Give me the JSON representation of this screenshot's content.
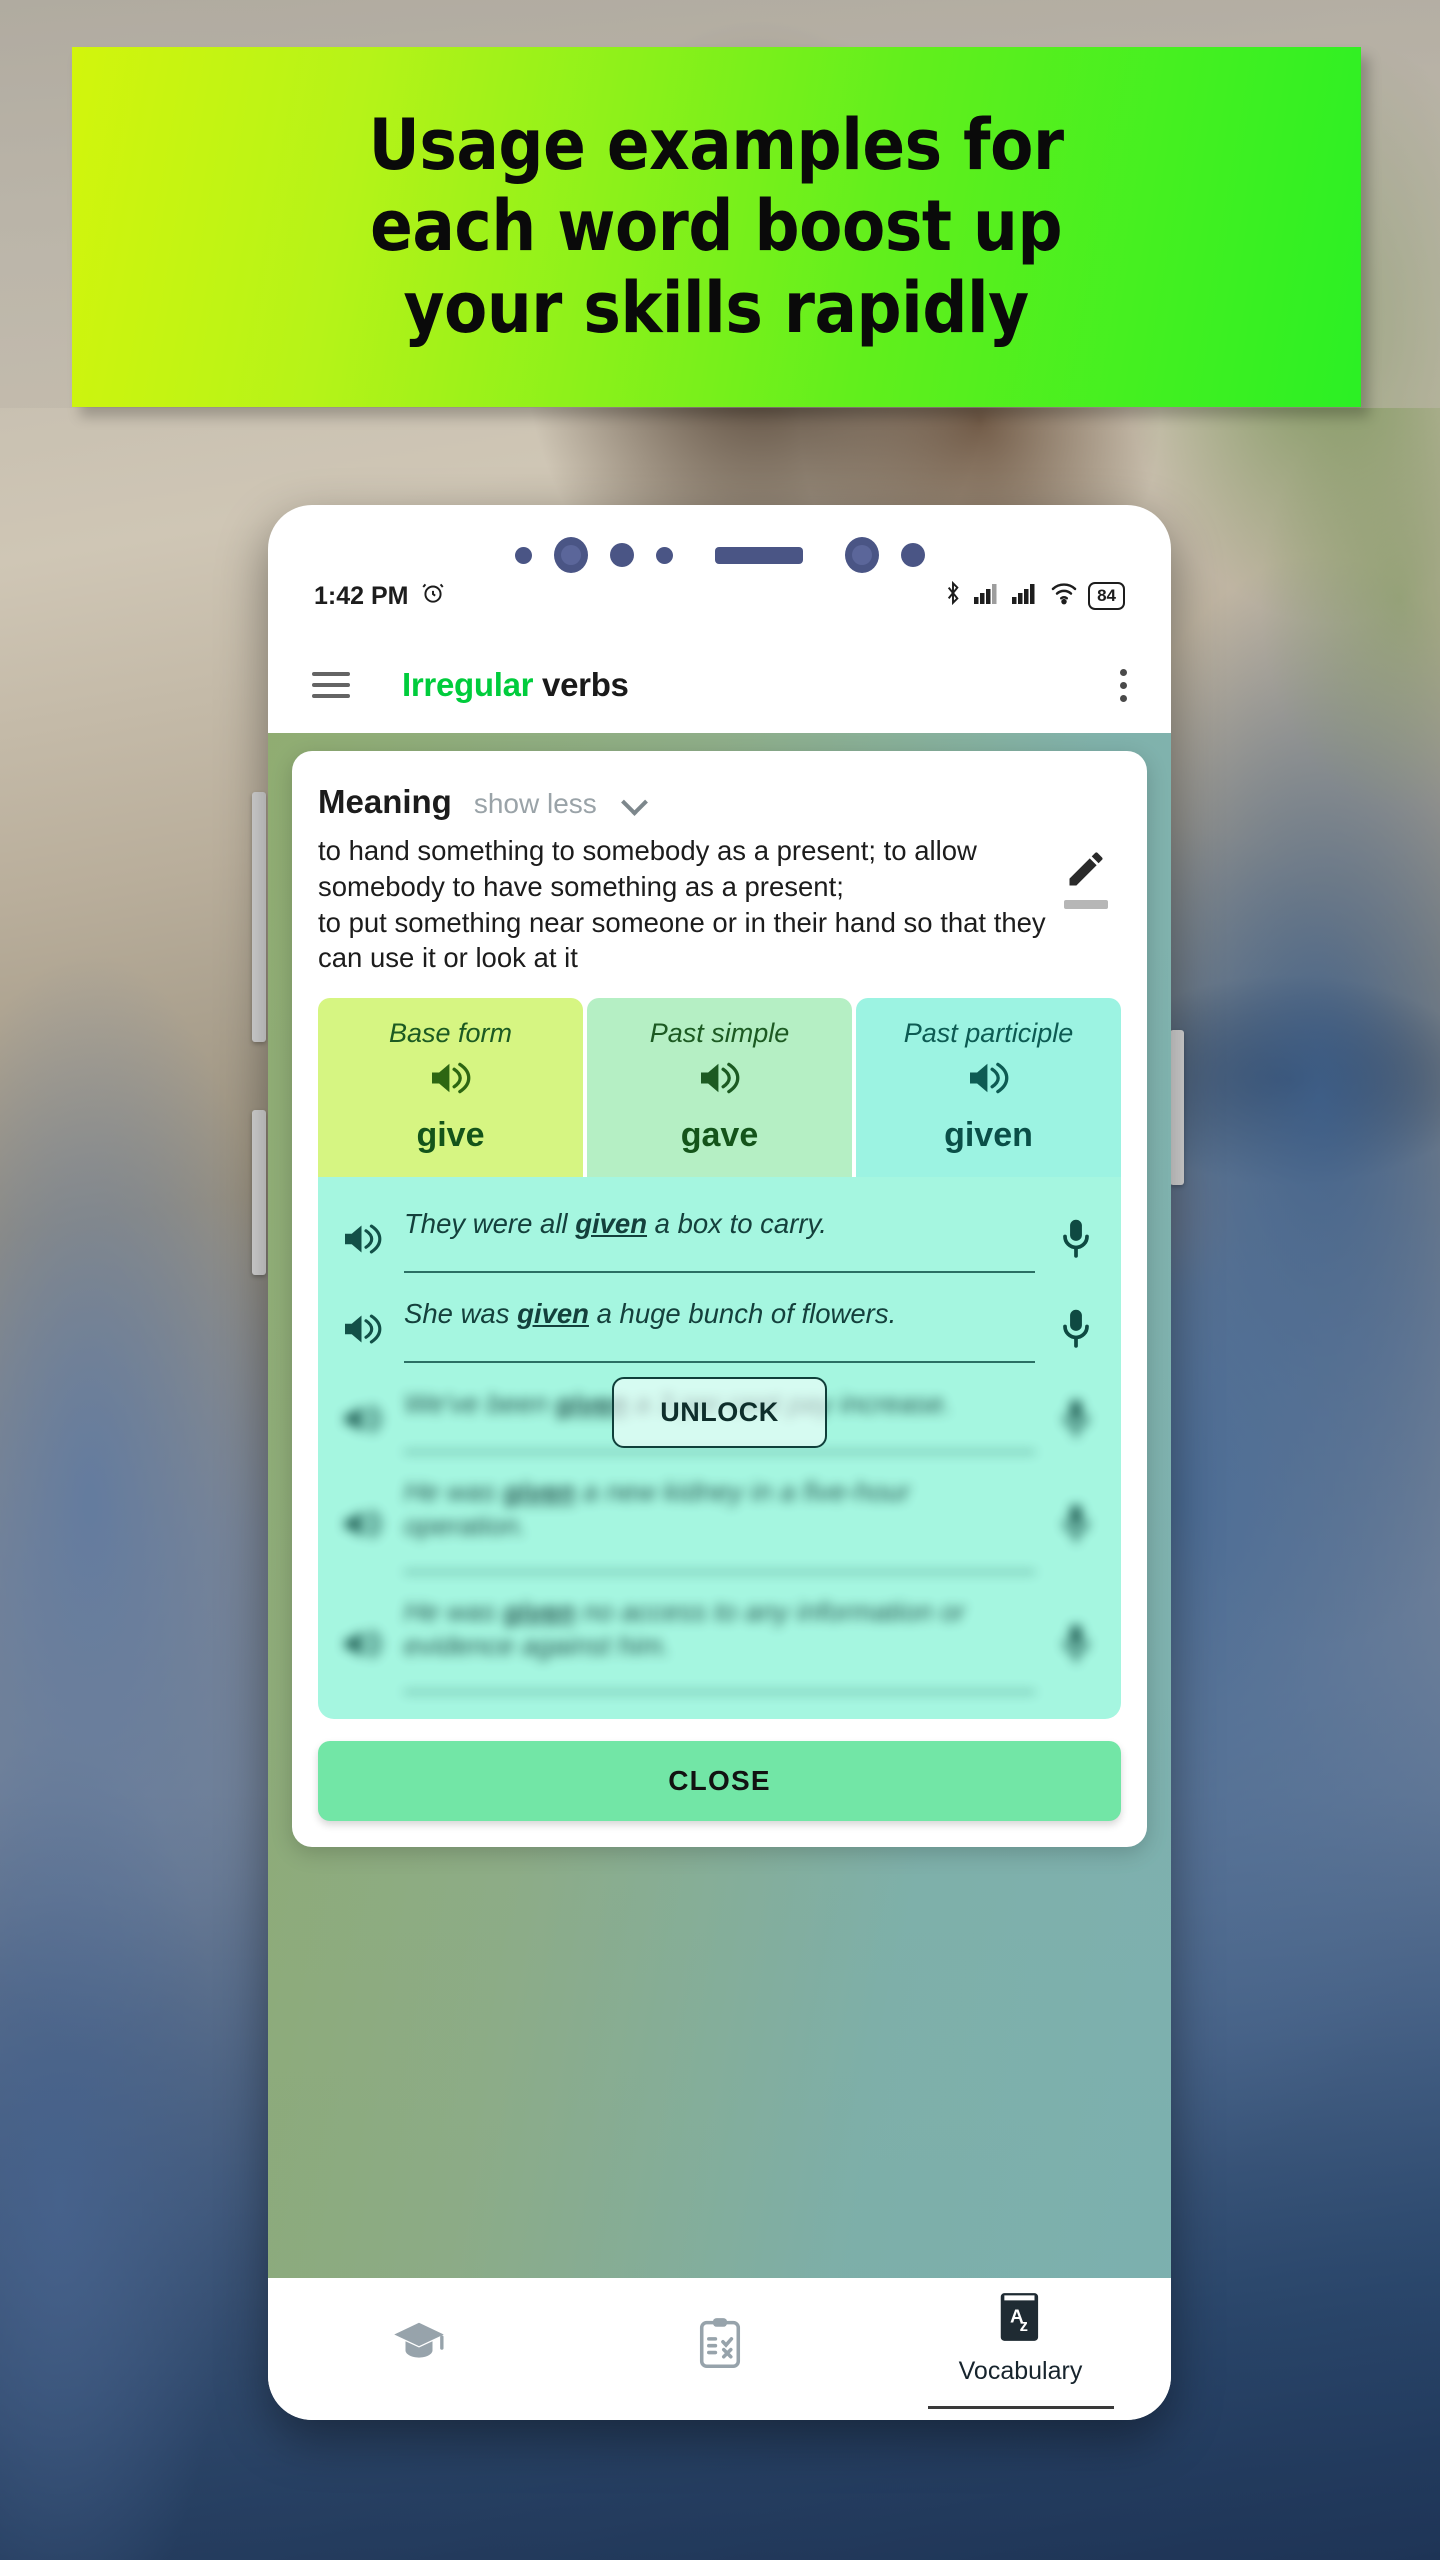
{
  "promo": {
    "headline": "Usage examples for\neach word boost up\nyour skills rapidly",
    "banner_gradient_from": "#d2f50c",
    "banner_gradient_to": "#2bf024"
  },
  "phone": {
    "statusbar": {
      "time": "1:42 PM",
      "alarm_icon": "alarm-icon",
      "bluetooth_icon": "bluetooth-icon",
      "signal_icon_1": "cellular-signal-icon",
      "signal_icon_2": "cellular-signal-icon",
      "wifi_icon": "wifi-icon",
      "battery_level": "84"
    },
    "appbar": {
      "menu_icon": "hamburger-menu-icon",
      "title_accent": "Irregular",
      "title_rest": " verbs",
      "accent_color": "#00cc3c",
      "overflow_icon": "kebab-menu-icon"
    }
  },
  "modal": {
    "meaning": {
      "title": "Meaning",
      "toggle_label": "show less",
      "toggle_icon": "chevron-down-icon",
      "text": "  to hand something to somebody as a present; to allow somebody to have something as a present;\n  to put something near someone or in their hand so that they can use it or look at it",
      "edit_icon": "pencil-edit-icon"
    },
    "forms": [
      {
        "label": "Base form",
        "word": "give",
        "speaker_icon": "speaker-icon",
        "bg": "#d6f582"
      },
      {
        "label": "Past simple",
        "word": "gave",
        "speaker_icon": "speaker-icon",
        "bg": "#b5efc4"
      },
      {
        "label": "Past participle",
        "word": "given",
        "speaker_icon": "speaker-icon",
        "bg": "#9cf3e2"
      }
    ],
    "examples": [
      {
        "before": "They were all ",
        "highlight": "given",
        "after": " a box to carry.",
        "locked": false,
        "speaker_icon": "speaker-icon",
        "mic_icon": "microphone-icon"
      },
      {
        "before": "She was ",
        "highlight": "given",
        "after": " a huge bunch of flowers.",
        "locked": false,
        "speaker_icon": "speaker-icon",
        "mic_icon": "microphone-icon"
      },
      {
        "before": "We've been ",
        "highlight": "given",
        "after": " a 3 per cent pay increase.",
        "locked": true,
        "speaker_icon": "speaker-icon",
        "mic_icon": "microphone-icon"
      },
      {
        "before": "He was ",
        "highlight": "given",
        "after": " a new kidney in a five-hour operation.",
        "locked": true,
        "speaker_icon": "speaker-icon",
        "mic_icon": "microphone-icon"
      },
      {
        "before": "He was ",
        "highlight": "given",
        "after": " no access to any information or evidence against him.",
        "locked": true,
        "speaker_icon": "speaker-icon",
        "mic_icon": "microphone-icon"
      }
    ],
    "unlock_label": "UNLOCK",
    "close_label": "CLOSE",
    "close_color": "#72e6a6"
  },
  "bottom_nav": [
    {
      "icon": "graduation-cap-icon",
      "label": "",
      "active": false
    },
    {
      "icon": "clipboard-test-icon",
      "label": "",
      "active": false
    },
    {
      "icon": "dictionary-az-icon",
      "label": "Vocabulary",
      "active": true
    }
  ]
}
